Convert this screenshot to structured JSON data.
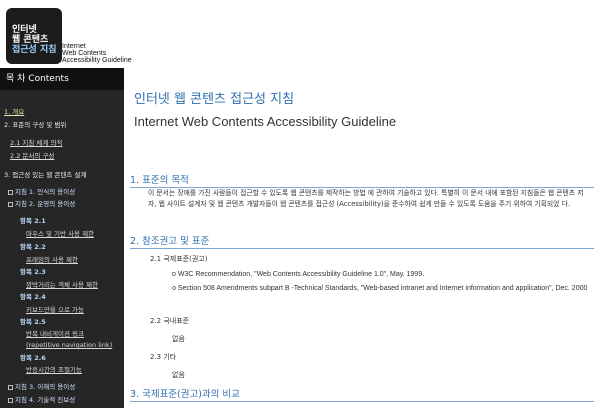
{
  "header": {
    "logo_lines": [
      "인터넷",
      "웹 콘텐츠",
      "접근성 지침"
    ],
    "en_lines": [
      "Internet",
      "Web Contents",
      "Accessibility Guideline"
    ]
  },
  "sidebar": {
    "title": "목 차 Contents",
    "items": [
      "1. 개요",
      "2. 표준의 구성 및 범위",
      "2.1 지침 체계 의적",
      "2.2 문서의 구성",
      "3. 접근성 있는 웹 콘텐츠 설계",
      "지침 1. 인식의 용이성",
      "지침 2. 운영의 용이성",
      "항목 2.1",
      "마우스 및 기반 사용 제한",
      "항목 2.2",
      "프레임의 사용 제한",
      "항목 2.3",
      "깜박거리는 객체 사용 제한",
      "항목 2.4",
      "키보드만을 으로 가능",
      "항목 2.5",
      "반복 내비게이션 링크",
      "(repetitive navigation link)",
      "항목 2.6",
      "반응시간의 조절기능",
      "지침 3. 이해의 용이성",
      "지침 4. 기술적 진보성"
    ]
  },
  "main": {
    "title_ko": "인터넷 웹 콘텐츠 접근성 지침",
    "title_en": "Internet Web Contents Accessibility Guideline",
    "sec1": "1. 표준의 목적",
    "para1": "이 문서는 장애를 가진 사람들이 접근할 수 있도록 웹 콘텐츠를 제작하는 방법 에 관하여 기술하고 있다. 특별히 이 문서 내에 포함된 지침들은 웹 콘텐츠 저 자, 웹 사이트 설계자 및 웹 콘텐츠 개발자들이 웹 콘텐츠를 접근성 (Accessibility)을 준수하여 쉽게 만들 수 있도록 도움을 주기 위하여 기획되었 다.",
    "sec2": "2. 참조권고 및 표준",
    "sub21": "2.1 국제표준(권고)",
    "ref1": "o W3C Recommendation, \"Web Contents Accessibility Guideline 1.0\", May. 1999.",
    "ref2": "o Section 508 Amendments subpart B -Technical Standards, \"Web-based intranet and Internet information and application\", Dec. 2000",
    "sub22": "2.2 국내표준",
    "none1": "없음",
    "sub23": "2.3 기타",
    "none2": "없음",
    "sec3": "3. 국제표준(권고)과의 비교"
  }
}
